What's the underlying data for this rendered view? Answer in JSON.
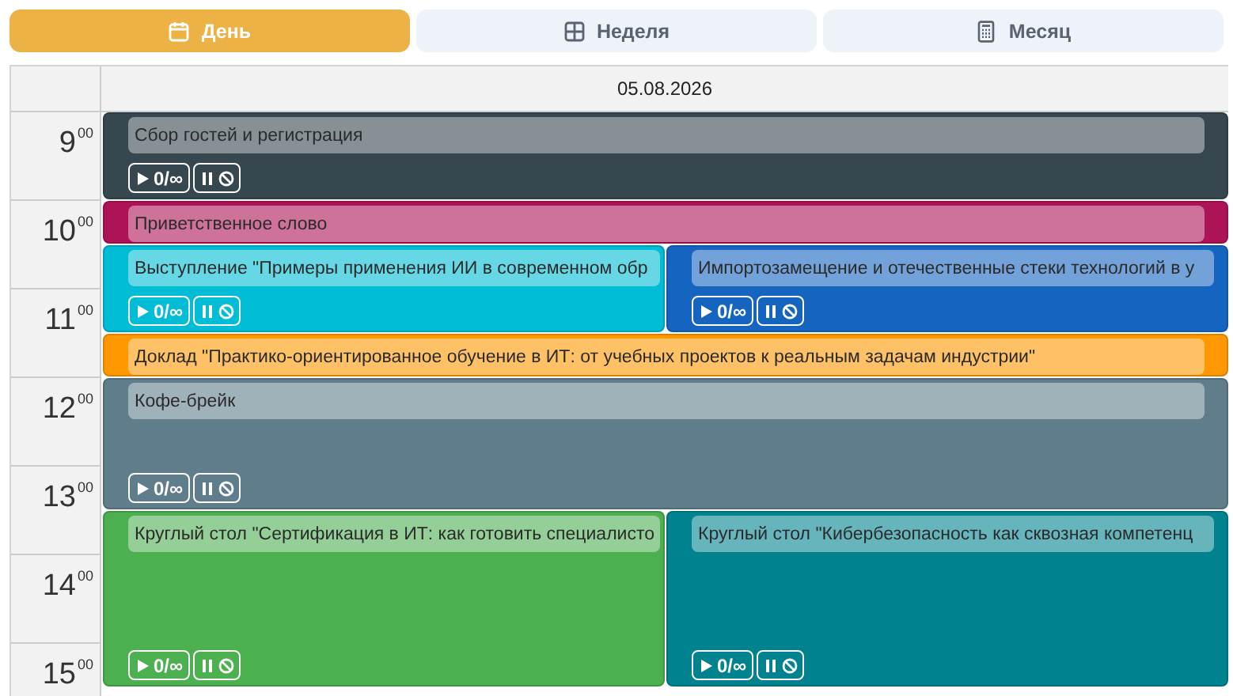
{
  "tabs": [
    {
      "label": "День",
      "kind": "day",
      "selected": true
    },
    {
      "label": "Неделя",
      "kind": "week",
      "selected": false
    },
    {
      "label": "Месяц",
      "kind": "month",
      "selected": false
    }
  ],
  "date": "05.08.2026",
  "hours": [
    {
      "hour": "9",
      "minutes": "00"
    },
    {
      "hour": "10",
      "minutes": "00"
    },
    {
      "hour": "11",
      "minutes": "00"
    },
    {
      "hour": "12",
      "minutes": "00"
    },
    {
      "hour": "13",
      "minutes": "00"
    },
    {
      "hour": "14",
      "minutes": "00"
    },
    {
      "hour": "15",
      "minutes": "00"
    }
  ],
  "rows": [
    {
      "events": [
        {
          "title": "Сбор гостей и регистрация",
          "color": "#37474f",
          "counter": "0/∞"
        }
      ]
    },
    {
      "events": [
        {
          "title": "Приветственное слово",
          "color": "#ad1457"
        }
      ]
    },
    {
      "events": [
        {
          "title": "Выступление \"Примеры применения ИИ в современном обр",
          "color": "#00bcd4",
          "counter": "0/∞"
        },
        {
          "title": "Импортозамещение и отечественные стеки технологий в у",
          "color": "#1565c0",
          "counter": "0/∞"
        }
      ]
    },
    {
      "events": [
        {
          "title": "Доклад \"Практико-ориентированное обучение в ИТ: от учебных проектов к реальным задачам индустрии\"",
          "color": "#ff9800"
        }
      ]
    },
    {
      "events": [
        {
          "title": "Кофе-брейк",
          "color": "#607d8b",
          "counter": "0/∞"
        }
      ]
    },
    {
      "events": [
        {
          "title": "Круглый стол \"Сертификация в ИТ: как готовить специалисто",
          "color": "#4caf50",
          "counter": "0/∞"
        },
        {
          "title": "Круглый стол \"Кибербезопасность как сквозная компетенц",
          "color": "#00838f",
          "counter": "0/∞"
        }
      ]
    }
  ]
}
